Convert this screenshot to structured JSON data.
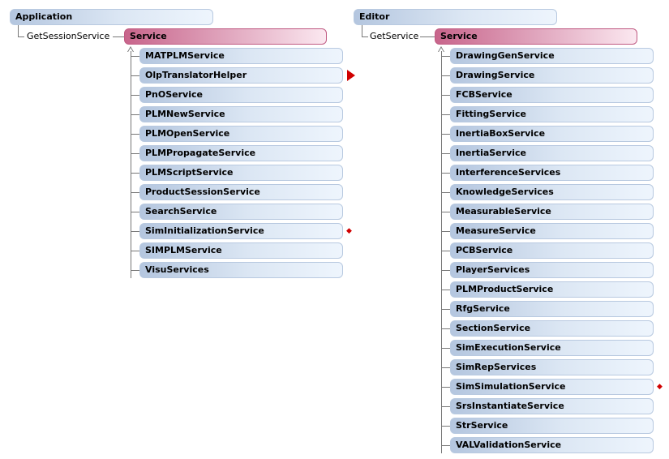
{
  "left": {
    "root": "Application",
    "relation": "GetSessionService",
    "target": "Service",
    "children": [
      "MATPLMService",
      "OlpTranslatorHelper",
      "PnOService",
      "PLMNewService",
      "PLMOpenService",
      "PLMPropagateService",
      "PLMScriptService",
      "ProductSessionService",
      "SearchService",
      "SimInitializationService",
      "SIMPLMService",
      "VisuServices"
    ]
  },
  "right": {
    "root": "Editor",
    "relation": "GetService",
    "target": "Service",
    "children": [
      "DrawingGenService",
      "DrawingService",
      "FCBService",
      "FittingService",
      "InertiaBoxService",
      "InertiaService",
      "InterferenceServices",
      "KnowledgeServices",
      "MeasurableService",
      "MeasureService",
      "PCBService",
      "PlayerServices",
      "PLMProductService",
      "RfgService",
      "SectionService",
      "SimExecutionService",
      "SimRepServices",
      "SimSimulationService",
      "SrsInstantiateService",
      "StrService",
      "VALValidationService"
    ]
  },
  "markers": {
    "left_flag_on": "OlpTranslatorHelper",
    "left_diamond_on": "SimInitializationService",
    "right_diamond_on": "SimSimulationService",
    "marker_color": "#d00000"
  }
}
